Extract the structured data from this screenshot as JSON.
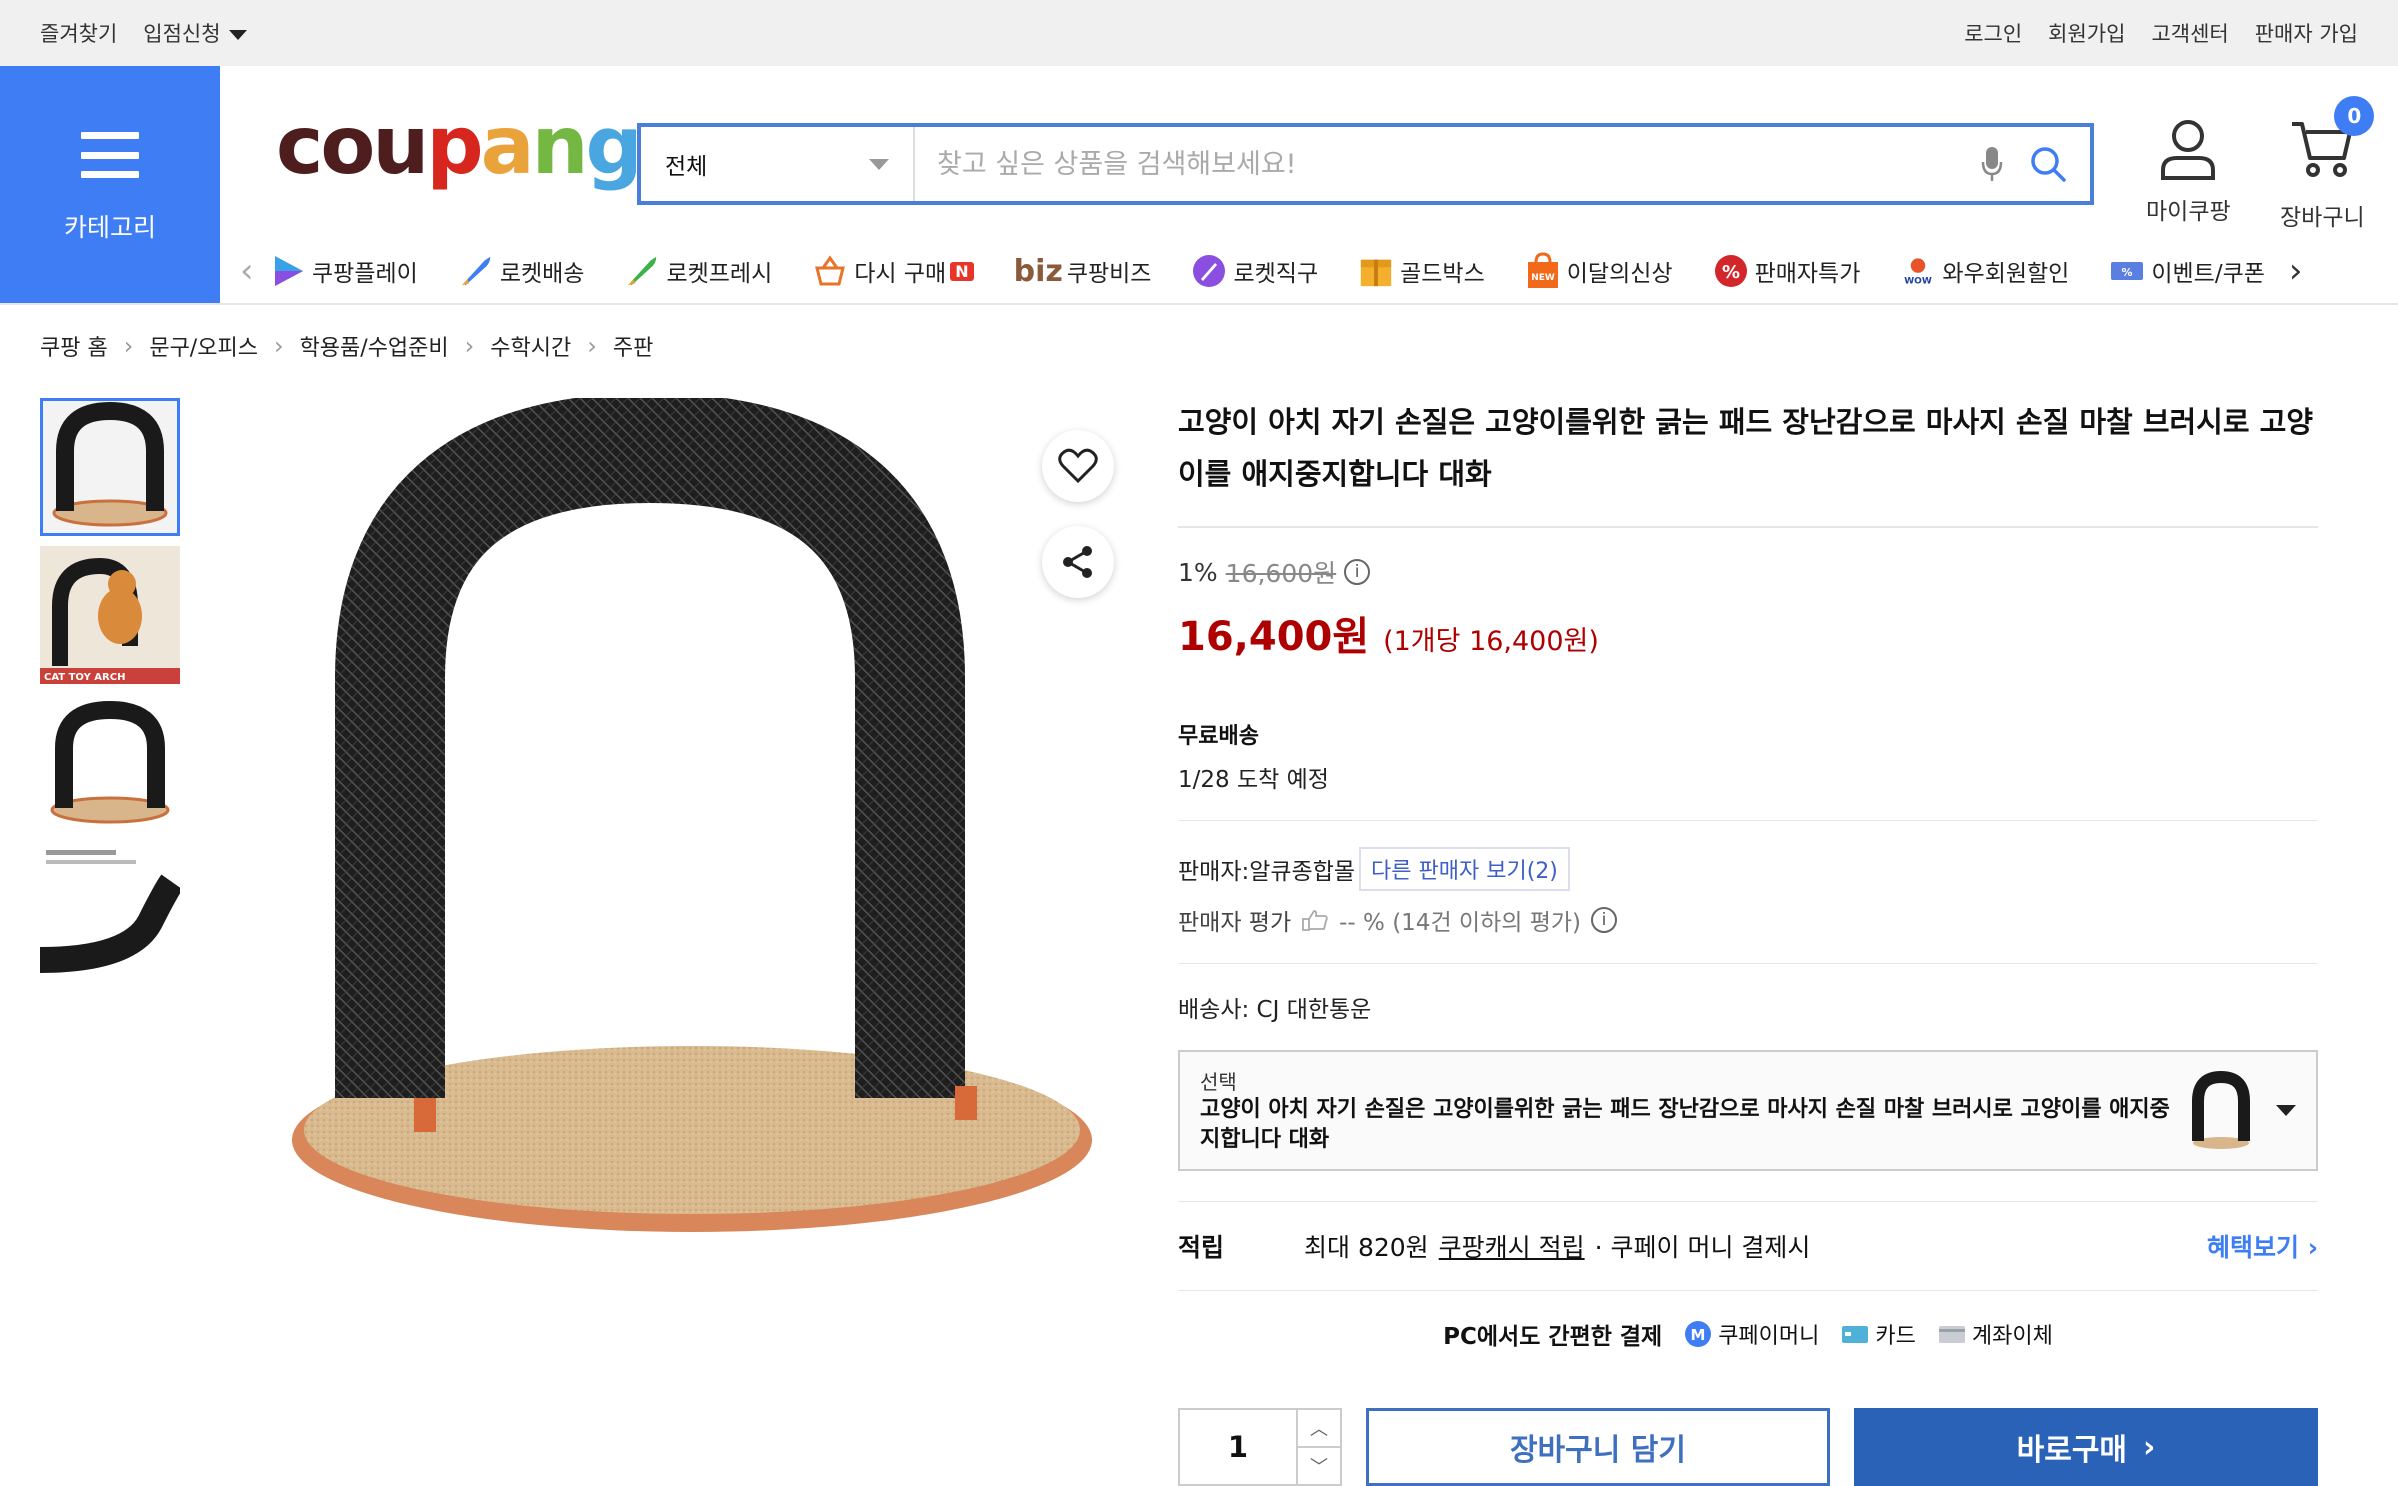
{
  "topbar": {
    "left": [
      "즐겨찾기",
      "입점신청"
    ],
    "right": [
      "로그인",
      "회원가입",
      "고객센터",
      "판매자 가입"
    ]
  },
  "category": {
    "label": "카테고리"
  },
  "logo": {
    "parts": [
      "cou",
      "p",
      "a",
      "n",
      "g"
    ]
  },
  "search": {
    "category": "전체",
    "placeholder": "찾고 싶은 상품을 검색해보세요!"
  },
  "header": {
    "mycoupang": "마이쿠팡",
    "cart": "장바구니",
    "cart_count": "0"
  },
  "nav": [
    {
      "label": "쿠팡플레이",
      "icon": "play-icon"
    },
    {
      "label": "로켓배송",
      "icon": "rocket-icon"
    },
    {
      "label": "로켓프레시",
      "icon": "rocket-fresh-icon"
    },
    {
      "label": "다시 구매",
      "icon": "basket-icon"
    },
    {
      "label": "쿠팡비즈",
      "icon": "biz-icon"
    },
    {
      "label": "로켓직구",
      "icon": "global-rocket-icon"
    },
    {
      "label": "골드박스",
      "icon": "goldbox-icon"
    },
    {
      "label": "이달의신상",
      "icon": "new-bag-icon"
    },
    {
      "label": "판매자특가",
      "icon": "percent-badge-icon"
    },
    {
      "label": "와우회원할인",
      "icon": "wow-icon"
    },
    {
      "label": "이벤트/쿠폰",
      "icon": "coupon-icon"
    }
  ],
  "nav_badges": {
    "rebuy": "N",
    "biz": "biz",
    "wow": "WOW",
    "coupon": "%",
    "new": "NEW"
  },
  "breadcrumb": [
    "쿠팡 홈",
    "문구/오피스",
    "학용품/수업준비",
    "수학시간",
    "주판"
  ],
  "product": {
    "title": "고양이 아치 자기 손질은 고양이를위한 긁는 패드 장난감으로 마사지 손질 마찰 브러시로 고양이를 애지중지합니다 대화",
    "discount": "1%",
    "original_price": "16,600원",
    "price": "16,400원",
    "unit_price": "(1개당 16,400원)",
    "shipping_label": "무료배송",
    "arrival": "1/28 도착 예정",
    "seller": "판매자:알큐종합몰",
    "other_sellers": "다른 판매자 보기(2)",
    "seller_rating_label": "판매자 평가",
    "seller_rating": "-- % (14건 이하의 평가)",
    "carrier": "배송사:  CJ 대한통운",
    "option_label": "선택",
    "option_value": "고양이 아치 자기 손질은 고양이를위한 긁는 패드 장난감으로 마사지 손질 마찰 브러시로 고양이를 애지중지합니다 대화",
    "reward_label": "적립",
    "reward_max": "최대 820원",
    "reward_cash": "쿠팡캐시 적립",
    "reward_pay": "· 쿠페이 머니 결제시",
    "reward_more": "혜택보기",
    "pay_title": "PC에서도 간편한 결제",
    "pay_methods": [
      "쿠페이머니",
      "카드",
      "계좌이체"
    ],
    "quantity": "1",
    "add_cart": "장바구니 담기",
    "buy_now": "바로구매",
    "thumb_caption": "CAT TOY ARCH"
  },
  "colors": {
    "accent": "#3f7df5",
    "price": "#ae0000",
    "buy": "#2a62b8"
  }
}
